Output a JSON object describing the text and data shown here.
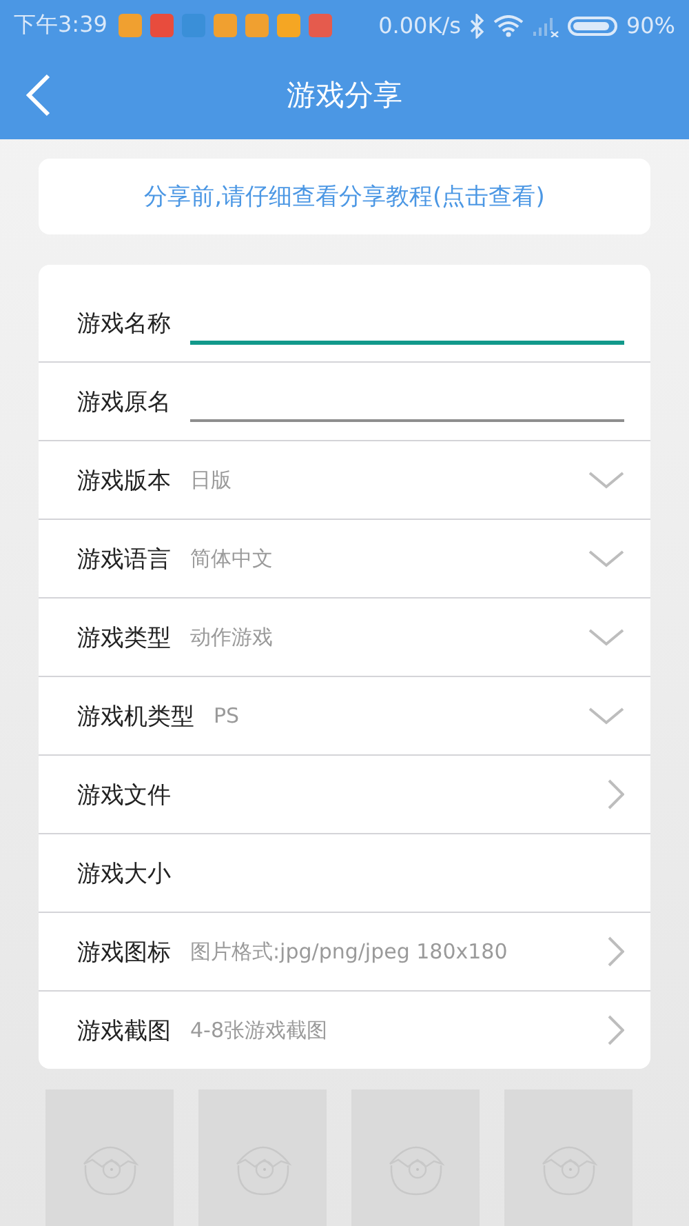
{
  "status_bar": {
    "time": "下午3:39",
    "app_icons": [
      {
        "color": "#f0a030"
      },
      {
        "color": "#e84c3d"
      },
      {
        "color": "#3a8fd8"
      },
      {
        "color": "#f0a030"
      },
      {
        "color": "#f0a030"
      },
      {
        "color": "#f5a623"
      },
      {
        "color": "#e55b4d"
      }
    ],
    "net_speed": "0.00K/s",
    "battery": "90%"
  },
  "header": {
    "title": "游戏分享"
  },
  "notice": {
    "text": "分享前,请仔细查看分享教程(点击查看)"
  },
  "form": [
    {
      "kind": "input",
      "label": "游戏名称",
      "focused": true
    },
    {
      "kind": "input",
      "label": "游戏原名",
      "focused": false
    },
    {
      "kind": "select",
      "label": "游戏版本",
      "value": "日版"
    },
    {
      "kind": "select",
      "label": "游戏语言",
      "value": "简体中文"
    },
    {
      "kind": "select",
      "label": "游戏类型",
      "value": "动作游戏"
    },
    {
      "kind": "select",
      "label": "游戏机类型",
      "value": "PS"
    },
    {
      "kind": "link",
      "label": "游戏文件"
    },
    {
      "kind": "plain",
      "label": "游戏大小"
    },
    {
      "kind": "link",
      "label": "游戏图标",
      "value": "图片格式:jpg/png/jpeg 180x180"
    },
    {
      "kind": "link",
      "label": "游戏截图",
      "value": "4-8张游戏截图"
    }
  ],
  "screenshots": [
    {
      "kind": "placeholder"
    },
    {
      "kind": "placeholder"
    },
    {
      "kind": "placeholder"
    },
    {
      "kind": "placeholder"
    }
  ]
}
